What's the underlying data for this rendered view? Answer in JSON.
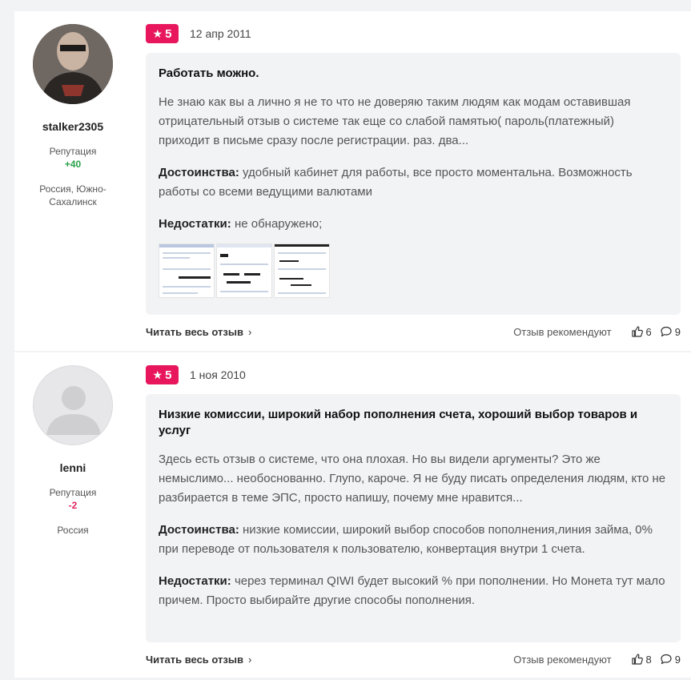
{
  "reviews": [
    {
      "author": {
        "username": "stalker2305",
        "reputation_label": "Репутация",
        "reputation_value": "+40",
        "location": "Россия, Южно-Сахалинск"
      },
      "rating": "5",
      "date": "12 апр 2011",
      "title": "Работать можно.",
      "body": "Не знаю как вы а лично я не то что не доверяю таким людям как модам оставившая отрицательный отзыв о системе так еще со слабой памятью( пароль(платежный) приходит в письме сразу после регистрации. раз. два...",
      "pros_label": "Достоинства:",
      "pros": "удобный кабинет для работы, все просто моментальна. Возможность работы со всеми ведущими валютами",
      "cons_label": "Недостатки:",
      "cons": "не обнаружено;",
      "read_more": "Читать весь отзыв",
      "recommend_label": "Отзыв рекомендуют",
      "likes": "6",
      "comments": "9"
    },
    {
      "author": {
        "username": "lenni",
        "reputation_label": "Репутация",
        "reputation_value": "-2",
        "location": "Россия"
      },
      "rating": "5",
      "date": "1 ноя 2010",
      "title": "Низкие комиссии, широкий набор пополнения счета, хороший выбор товаров и услуг",
      "body": "Здесь есть отзыв о системе, что она плохая. Но вы видели аргументы? Это же немыслимо... необоснованно. Глупо, кароче. Я не буду писать определения людям, кто не разбирается в теме ЭПС, просто напишу, почему мне нравится...",
      "pros_label": "Достоинства:",
      "pros": "низкие комиссии, широкий выбор способов пополнения,линия займа, 0% при переводе от пользователя к пользователю, конвертация внутри 1 счета.",
      "cons_label": "Недостатки:",
      "cons": "через терминал QIWI будет высокий % при пополнении. Но Монета тут мало причем. Просто выбирайте другие способы пополнения.",
      "read_more": "Читать весь отзыв",
      "recommend_label": "Отзыв рекомендуют",
      "likes": "8",
      "comments": "9"
    }
  ],
  "colors": {
    "badge": "#e8175d",
    "positive": "#2ca24b",
    "negative": "#e0245e",
    "card_bg": "#f2f3f5"
  },
  "icons": {
    "star": "star-icon",
    "like": "thumbs-up-icon",
    "comment": "comment-icon",
    "chevron": "chevron-right-icon"
  }
}
